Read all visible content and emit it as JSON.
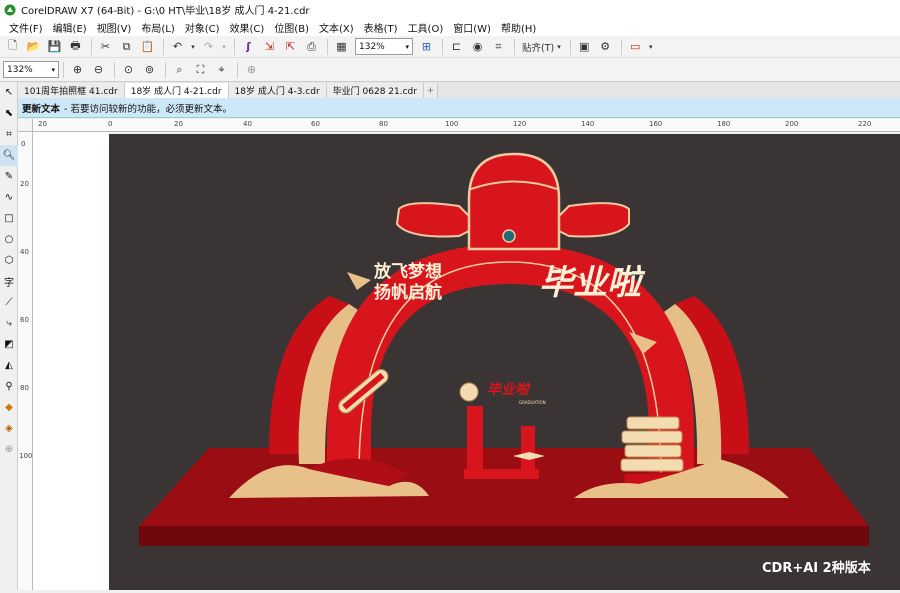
{
  "window": {
    "title": "CorelDRAW X7 (64-Bit) - G:\\0 HT\\毕业\\18岁 成人门 4-21.cdr"
  },
  "menu": [
    "文件(F)",
    "编辑(E)",
    "视图(V)",
    "布局(L)",
    "对象(C)",
    "效果(C)",
    "位图(B)",
    "文本(X)",
    "表格(T)",
    "工具(O)",
    "窗口(W)",
    "帮助(H)"
  ],
  "toolbar": {
    "zoom_value": "132%",
    "snap_label": "贴齐(T)"
  },
  "propertybar": {
    "zoom_value": "132%"
  },
  "doc_tabs": [
    "101周年拍照框 41.cdr",
    "18岁 成人门 4-21.cdr",
    "18岁 成人门 4-3.cdr",
    "毕业门 0628 21.cdr"
  ],
  "infobar": {
    "title": "更新文本",
    "message": "- 若要访问较新的功能，必须更新文本。"
  },
  "ruler": {
    "h_labels": [
      "20",
      "0",
      "20",
      "40",
      "60",
      "80",
      "100",
      "120",
      "140",
      "160",
      "180",
      "200",
      "220"
    ],
    "v_labels": [
      "0",
      "20",
      "40",
      "60",
      "80",
      "100"
    ]
  },
  "artwork": {
    "slogan_line1": "放飞梦想",
    "slogan_line2": "扬帆启航",
    "headline": "毕业啦",
    "small_headline": "毕业啦",
    "small_sub": "GRADUATION",
    "colors": {
      "red": "#d8141c",
      "dark_red": "#8e0d12",
      "gold": "#e8c08a",
      "cream": "#f3dcb0",
      "bg": "#3a3534"
    }
  },
  "watermark": "CDR+AI 2种版本"
}
